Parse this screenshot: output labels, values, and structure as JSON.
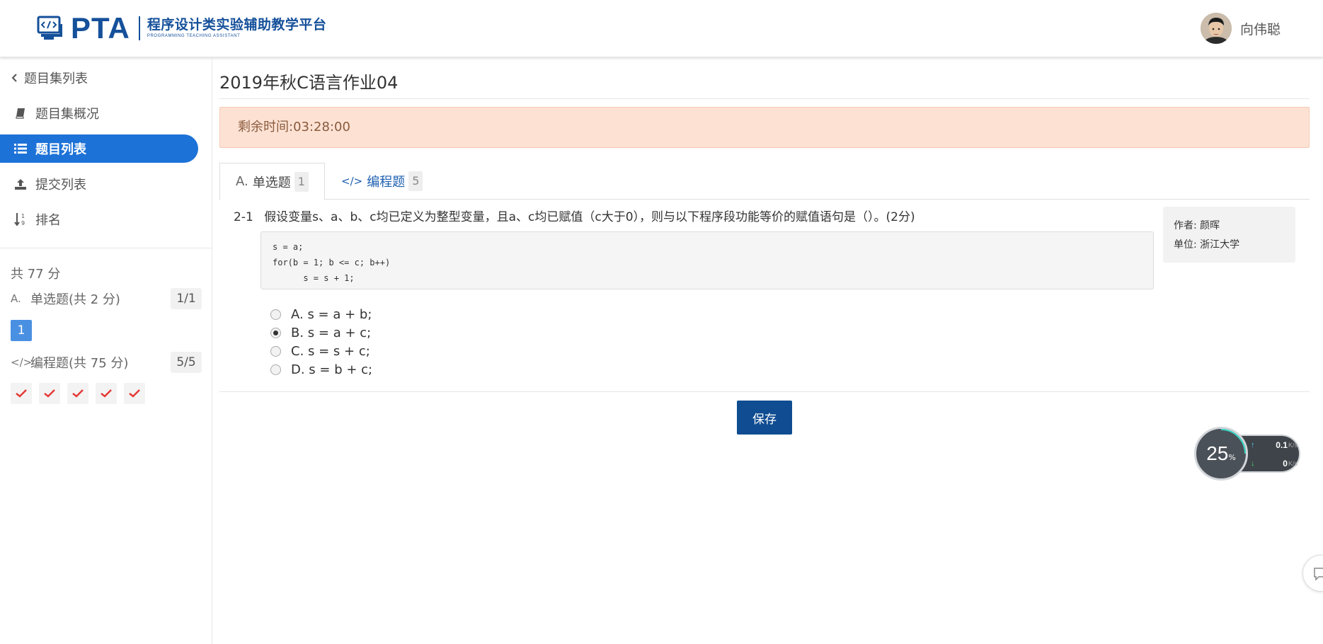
{
  "header": {
    "logo_text": "PTA",
    "logo_subtitle": "程序设计类实验辅助教学平台",
    "logo_subtitle_en": "PROGRAMMING TEACHING ASSISTANT",
    "username": "向伟聪"
  },
  "sidebar": {
    "items": [
      {
        "label": "题目集列表",
        "icon": "chevron-left-icon"
      },
      {
        "label": "题目集概况",
        "icon": "book-icon"
      },
      {
        "label": "题目列表",
        "icon": "list-icon",
        "active": true
      },
      {
        "label": "提交列表",
        "icon": "upload-icon"
      },
      {
        "label": "排名",
        "icon": "sort-numeric-icon"
      }
    ],
    "total_score": "共 77 分",
    "categories": [
      {
        "icon_text": "A.",
        "label": "单选题(共 2 分)",
        "count": "1/1",
        "questions": [
          "1"
        ]
      },
      {
        "icon_text": "</>",
        "label": "编程题(共 75 分)",
        "count": "5/5",
        "completed": 5
      }
    ]
  },
  "main": {
    "title": "2019年秋C语言作业04",
    "timer": "剩余时间:03:28:00",
    "tabs": [
      {
        "icon_text": "A.",
        "label": "单选题",
        "count": "1",
        "active": true
      },
      {
        "icon_text": "</>",
        "label": "编程题",
        "count": "5",
        "active": false
      }
    ],
    "question": {
      "number": "2-1",
      "text": "假设变量s、a、b、c均已定义为整型变量，且a、c均已赋值（c大于0），则与以下程序段功能等价的赋值语句是（）。(2分)",
      "code": "s = a;\nfor(b = 1; b <= c; b++)\n      s = s + 1;",
      "options": [
        {
          "label": "A. s = a + b;",
          "checked": false
        },
        {
          "label": "B. s = a + c;",
          "checked": true
        },
        {
          "label": "C. s = s + c;",
          "checked": false
        },
        {
          "label": "D. s = b + c;",
          "checked": false
        }
      ],
      "author": "作者: 颜晖",
      "unit": "单位: 浙江大学"
    },
    "save_label": "保存"
  },
  "speed_widget": {
    "percent": "25",
    "percent_symbol": "%",
    "upload_value": "0.1",
    "download_value": "0",
    "unit": "K/s"
  },
  "colors": {
    "brand": "#15509a",
    "active_nav": "#1d72d8",
    "save_button": "#0f4c91",
    "timer_bg": "#fde2d4",
    "check_red": "#e53935"
  }
}
